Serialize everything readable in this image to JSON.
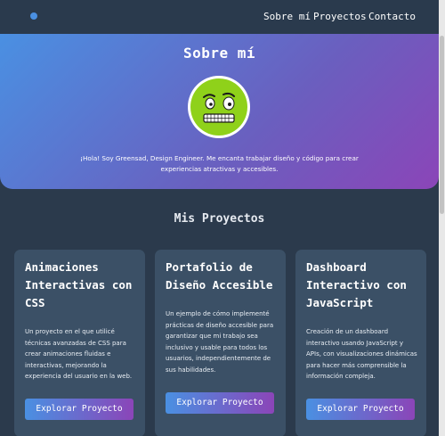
{
  "nav": {
    "links": [
      "Sobre mí",
      "Proyectos",
      "Contacto"
    ]
  },
  "hero": {
    "title": "Sobre mí",
    "description": "¡Hola! Soy Greensad, Design Engineer. Me encanta trabajar diseño y código para crear experiencias atractivas y accesibles.",
    "avatar_icon": "green-smiley-avatar-icon"
  },
  "projects": {
    "title": "Mis Proyectos",
    "cards": [
      {
        "title": "Animaciones Interactivas con CSS",
        "description": "Un proyecto en el que utilicé técnicas avanzadas de CSS para crear animaciones fluidas e interactivas, mejorando la experiencia del usuario en la web.",
        "button": "Explorar Proyecto"
      },
      {
        "title": "Portafolio de Diseño Accesible",
        "description": "Un ejemplo de cómo implementé prácticas de diseño accesible para garantizar que mi trabajo sea inclusivo y usable para todos los usuarios, independientemente de sus habilidades.",
        "button": "Explorar Proyecto"
      },
      {
        "title": "Dashboard Interactivo con JavaScript",
        "description": "Creación de un dashboard interactivo usando JavaScript y APIs, con visualizaciones dinámicas para hacer más comprensible la información compleja.",
        "button": "Explorar Proyecto"
      }
    ]
  },
  "colors": {
    "background": "#2b3a4c",
    "card": "#3b5066",
    "gradient_start": "#4a90e2",
    "gradient_end": "#8b45b8",
    "avatar_green": "#8fd11a"
  }
}
